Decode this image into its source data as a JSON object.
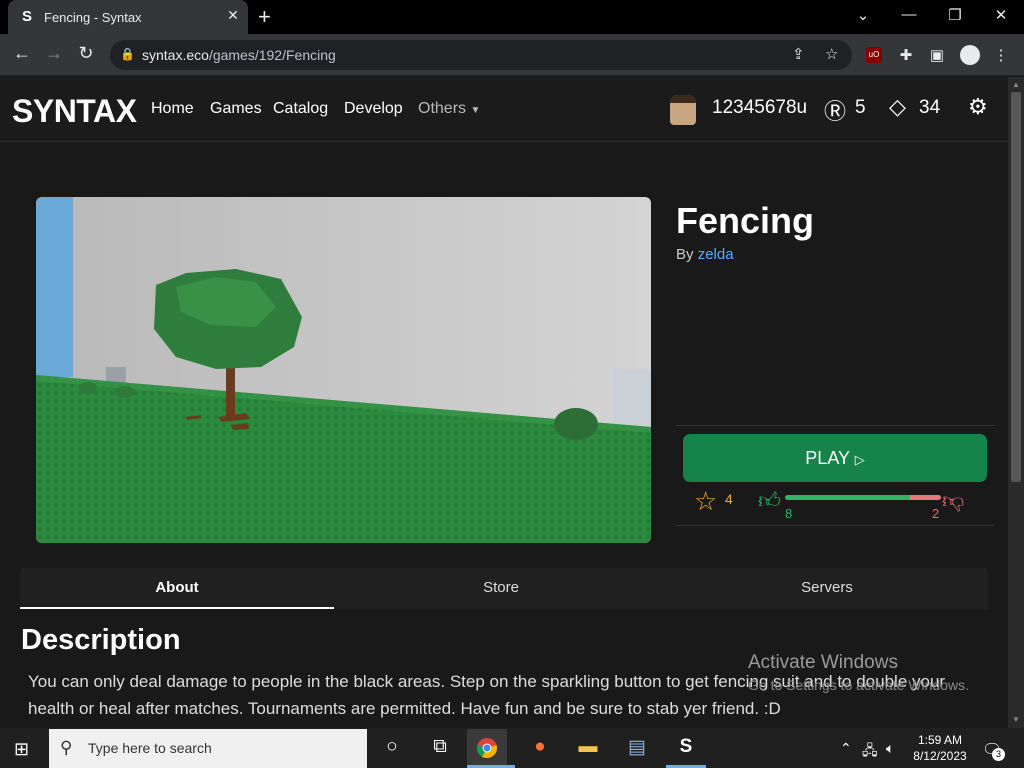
{
  "browser": {
    "tab_title": "Fencing - Syntax",
    "tab_favicon": "S",
    "url_domain": "syntax.eco",
    "url_path": "/games/192/Fencing",
    "icons": [
      "back-icon",
      "forward-icon",
      "reload-icon",
      "lock-icon",
      "share-icon",
      "star-icon",
      "ublock-icon",
      "puzzle-icon",
      "sidepanel-icon",
      "profile-icon",
      "kebab-icon"
    ]
  },
  "site": {
    "logo": "SYNTAX",
    "nav": [
      "Home",
      "Games",
      "Catalog",
      "Develop"
    ],
    "others_label": "Others",
    "username": "12345678u",
    "robux": "5",
    "tix": "34"
  },
  "game": {
    "title": "Fencing",
    "by_label": "By",
    "creator": "zelda",
    "play_label": "PLAY",
    "favorites": "4",
    "upvotes": "8",
    "downvotes": "2",
    "upvote_ratio": 0.8
  },
  "tabs": [
    "About",
    "Store",
    "Servers"
  ],
  "active_tab": "About",
  "description": {
    "title": "Description",
    "text": "You can only deal damage to people in the black areas. Step on the sparkling button to get fencing suit and to double your health or heal after matches. Tournaments are permitted. Have fun and be sure to stab yer friend. :D"
  },
  "watermark": {
    "title": "Activate Windows",
    "sub": "Go to Settings to activate Windows."
  },
  "taskbar": {
    "search_placeholder": "Type here to search",
    "time": "1:59 AM",
    "date": "8/12/2023",
    "notifications": "3"
  },
  "colors": {
    "play": "#15834a",
    "link": "#5aa9ff",
    "upvote": "#2fb463",
    "downvote": "#e06c6c",
    "favorite": "#f0ad2d"
  }
}
